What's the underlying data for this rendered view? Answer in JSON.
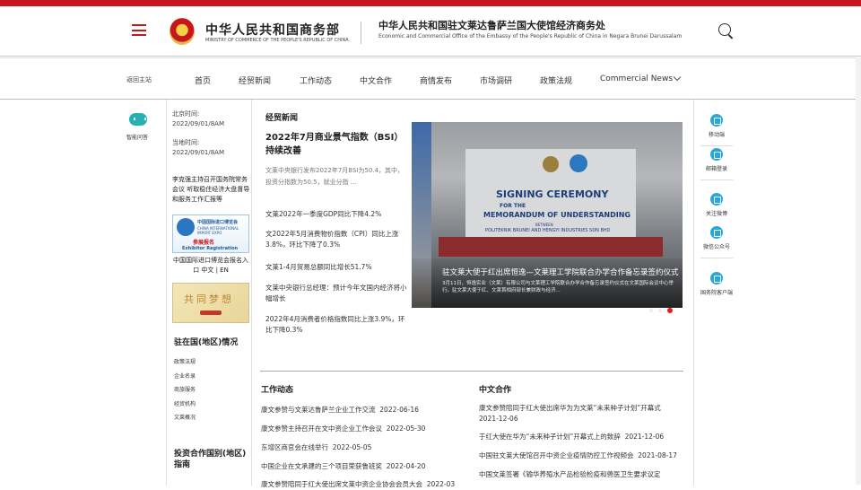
{
  "header": {
    "ministry_cn": "中华人民共和国商务部",
    "ministry_en": "MINISTRY OF COMMERCE OF THE PEOPLE'S REPUBLIC OF CHINA",
    "office_cn": "中华人民共和国驻文莱达鲁萨兰国大使馆经济商务处",
    "office_en": "Economic and Commercial Office of the Embassy of the People's Republic of China in Negara Brunei Darussalam"
  },
  "nav": {
    "back": "返回主站",
    "items": [
      "首页",
      "经贸新闻",
      "工作动态",
      "中文合作",
      "商情发布",
      "市场调研",
      "政策法规",
      "Commercial News"
    ]
  },
  "left_float": {
    "label": "智能问答"
  },
  "sidebar": {
    "beijing_label": "北京时间:",
    "beijing_time": "2022/09/01/8AM",
    "local_label": "当地时间:",
    "local_time": "2022/09/01/8AM",
    "news": "李克强主持召开国务院常务会议 听取稳住经济大盘督导和服务工作汇报等",
    "expo_title": "中国国际进口博览会",
    "expo_sub": "CHINA INTERNATIONAL IMPORT EXPO",
    "expo_cn": "参展报名",
    "expo_en": "Exhibitor Registration",
    "expo_caption": "中国国际进口博览会报名入口 中文 | EN",
    "brush_text": "共同梦想",
    "country_heading": "驻在国(地区)情况",
    "country_links": [
      "政策法规",
      "企业名录",
      "商旅服务",
      "经贸机构",
      "文莱概况"
    ],
    "guide_heading": "投资合作国别(地区)指南"
  },
  "main": {
    "section_title": "经贸新闻",
    "headline": "2022年7月商业景气指数（BSI）持续改善",
    "summary": "文莱中央银行发布2022年7月BSI为50.4，其中，投资分指数为50.5，就业分指 ...",
    "news_list": [
      "文莱2022年一季度GDP同比下降4.2%",
      "文2022年5月消费物价指数（CPI）同比上涨3.8%，环比下降了0.3%",
      "文莱1-4月贸易总额同比增长51.7%",
      "文莱中央银行总经理：预计今年文国内经济将小幅增长",
      "2022年4月消费者价格指数同比上涨3.9%，环比下降0.3%"
    ],
    "photo": {
      "board_title": "SIGNING CEREMONY",
      "board_for": "FOR THE",
      "board_mou": "MEMORANDUM OF UNDERSTANDING",
      "board_between": "BETWEEN",
      "board_parties": "POLITEKNIK BRUNEI AND HENGYI INDUSTRIES SDN BHD",
      "caption_title": "驻文莱大使于红出席恒逸—文莱理工学院联合办学合作备忘录签约仪式",
      "caption_desc": "3月11日，恒逸实业（文莱）有限公司与文莱理工学院联合办学合作备忘录签约仪式在文莱国际会议中心举行。驻文莱大使于红、文莱首相府部长兼财政与经济..."
    },
    "work": {
      "heading": "工作动态",
      "items": [
        {
          "text": "康文参赞与文莱达鲁萨兰企业工作交流",
          "date": "2022-06-16"
        },
        {
          "text": "康文参赞主持召开在文中资企业工作会议",
          "date": "2022-05-30"
        },
        {
          "text": "东增区商官会在线举行",
          "date": "2022-05-05"
        },
        {
          "text": "中国企业在文承建的三个项目荣获鲁班奖",
          "date": "2022-04-20"
        },
        {
          "text": "康文参赞陪同于红大使出席文莱中资企业协会会员大会",
          "date": "2022-03"
        }
      ]
    },
    "coop": {
      "heading": "中文合作",
      "items": [
        {
          "text": "康文参赞陪同于红大使出席华为为文莱“未来种子计划”开幕式",
          "date": "2021-12-06"
        },
        {
          "text": "于红大使在华为“未来种子计划”开幕式上的致辞",
          "date": "2021-12-06"
        },
        {
          "text": "中国驻文莱大使馆召开中资企业疫情防控工作视频会",
          "date": "2021-08-17"
        },
        {
          "text": "中国文莱签署《输华养殖水产品检验检疫和兽医卫生要求议定",
          "date": ""
        }
      ]
    }
  },
  "right_float": {
    "items": [
      "移动端",
      "邮箱登录",
      "关注微博",
      "微信公众号",
      "国务院客户端"
    ]
  },
  "colors": {
    "brand_red": "#c8161d",
    "teal": "#26b1b3",
    "blue": "#2aa7d9"
  }
}
